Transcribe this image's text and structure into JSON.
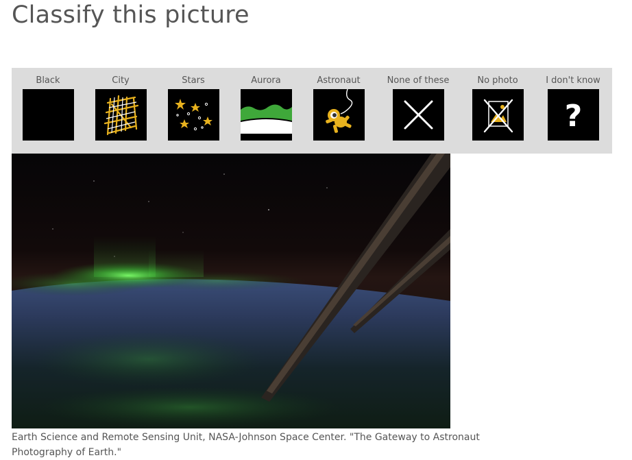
{
  "page": {
    "title": "Classify this picture"
  },
  "options": [
    {
      "label": "Black",
      "icon": "black-square-icon"
    },
    {
      "label": "City",
      "icon": "city-map-icon"
    },
    {
      "label": "Stars",
      "icon": "stars-icon"
    },
    {
      "label": "Aurora",
      "icon": "aurora-icon"
    },
    {
      "label": "Astronaut",
      "icon": "astronaut-icon"
    },
    {
      "label": "None of these",
      "icon": "x-cross-icon"
    },
    {
      "label": "No photo",
      "icon": "no-photo-icon"
    },
    {
      "label": "I don't know",
      "icon": "question-mark-icon"
    }
  ],
  "photo": {
    "credit": "Earth Science and Remote Sensing Unit, NASA-Johnson Space Center. \"The Gateway to Astronaut Photography of Earth.\""
  },
  "colors": {
    "toolbar_bg": "#dcdcdc",
    "accent_yellow": "#e8b21e",
    "aurora_green": "#3fa83a",
    "text_gray": "#555555"
  }
}
